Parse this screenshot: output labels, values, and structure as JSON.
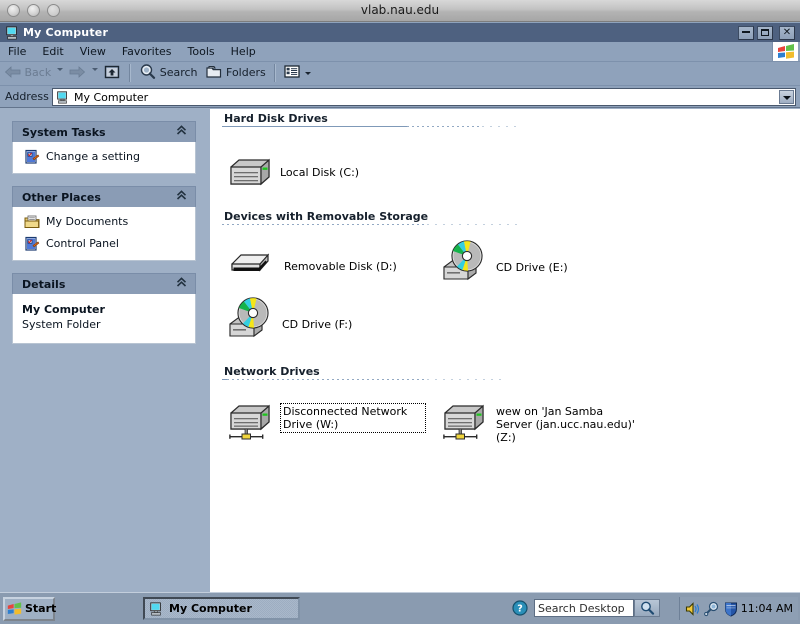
{
  "host_window": {
    "title": "vlab.nau.edu",
    "buttons": [
      "close",
      "minimize",
      "maximize"
    ]
  },
  "window": {
    "title": "My Computer",
    "icon": "my-computer-icon",
    "controls": {
      "minimize": "_",
      "maximize": "❐",
      "close": "✕"
    }
  },
  "menubar": {
    "items": [
      {
        "label": "File"
      },
      {
        "label": "Edit"
      },
      {
        "label": "View"
      },
      {
        "label": "Favorites"
      },
      {
        "label": "Tools"
      },
      {
        "label": "Help"
      }
    ],
    "brand_icon": "windows-flag-icon"
  },
  "toolbar": {
    "back_label": "Back",
    "forward_label": "",
    "up_label": "",
    "search_label": "Search",
    "folders_label": "Folders",
    "views_label": ""
  },
  "address": {
    "label": "Address",
    "value": "My Computer",
    "icon": "my-computer-icon"
  },
  "sidebar": {
    "panels": [
      {
        "title": "System Tasks",
        "collapse_glyph": "«",
        "rows": [
          {
            "label": "Change a setting",
            "icon": "control-panel-icon"
          }
        ]
      },
      {
        "title": "Other Places",
        "collapse_glyph": "«",
        "rows": [
          {
            "label": "My Documents",
            "icon": "my-documents-icon"
          },
          {
            "label": "Control Panel",
            "icon": "control-panel-icon"
          }
        ]
      },
      {
        "title": "Details",
        "collapse_glyph": "«",
        "detail_title": "My Computer",
        "detail_sub": "System Folder"
      }
    ]
  },
  "content": {
    "groups": [
      {
        "title": "Hard Disk Drives",
        "items": [
          {
            "label": "Local Disk (C:)",
            "icon": "hard-disk-icon",
            "focused": false
          }
        ]
      },
      {
        "title": "Devices with Removable Storage",
        "items": [
          {
            "label": "Removable Disk (D:)",
            "icon": "removable-disk-icon",
            "focused": false
          },
          {
            "label": "CD Drive (E:)",
            "icon": "cd-drive-icon",
            "focused": false
          },
          {
            "label": "CD Drive (F:)",
            "icon": "cd-drive-icon",
            "focused": false
          }
        ]
      },
      {
        "title": "Network Drives",
        "items": [
          {
            "label": "Disconnected Network Drive (W:)",
            "icon": "network-drive-icon",
            "focused": true
          },
          {
            "label": "wew on 'Jan Samba Server (jan.ucc.nau.edu)' (Z:)",
            "icon": "network-drive-icon",
            "focused": false
          }
        ]
      }
    ]
  },
  "taskbar": {
    "start_label": "Start",
    "start_icon": "windows-flag-icon",
    "tasks": [
      {
        "label": "My Computer",
        "icon": "my-computer-icon",
        "active": true
      }
    ],
    "search": {
      "placeholder": "Search Desktop",
      "value": "",
      "help_icon": "help-question-icon",
      "go_icon": "search-magnifier-icon"
    },
    "tray": {
      "icons": [
        "volume-speaker-icon",
        "search-magnifier-icon",
        "security-shield-icon"
      ],
      "time": "11:04 AM"
    }
  },
  "colors": {
    "xp_titlebar": "#4e6180",
    "xp_chrome": "#8fa2bb",
    "panel_header": "#8a9cb5",
    "desktop": "#8a9bb0",
    "content_bg": "#ffffff",
    "group_title": "#16202c"
  }
}
